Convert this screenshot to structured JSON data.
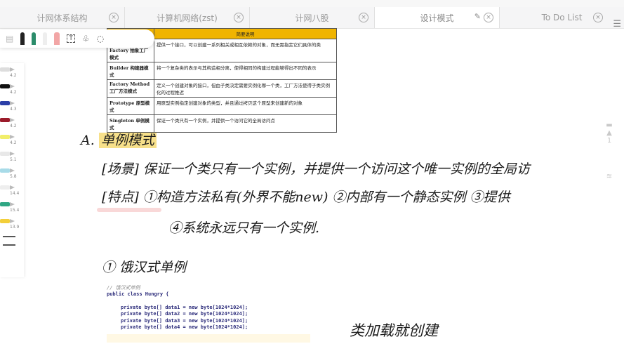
{
  "tabs": [
    {
      "label": "计网体系结构"
    },
    {
      "label": "计算机网络(zst)"
    },
    {
      "label": "计网八股"
    },
    {
      "label": "设计模式",
      "active": true
    },
    {
      "label": "To Do List"
    }
  ],
  "pens": [
    {
      "color": "#d8d8d8",
      "size": "4.2"
    },
    {
      "color": "#111111",
      "size": "4.2"
    },
    {
      "color": "#2b3fa8",
      "size": "4.3"
    },
    {
      "color": "#9b1b2a",
      "size": "4.2"
    },
    {
      "color": "#f1ee6a",
      "size": "4.2"
    },
    {
      "color": "#e8e8e8",
      "size": "5.1"
    },
    {
      "color": "#a8dbe8",
      "size": "5.8"
    },
    {
      "color": "#eeeeee",
      "size": "14.4"
    },
    {
      "color": "#2fa784",
      "size": "15.4"
    },
    {
      "color": "#f3cf3a",
      "size": "13.9"
    }
  ],
  "table": {
    "header": "简要说明",
    "rows": [
      {
        "name": "Abstract Factory 抽象工厂模式",
        "desc": "提供一个接口，可以创建一系列相关或相互依赖的对象，而无需指定它们具体的类"
      },
      {
        "name": "Builder 构建器模式",
        "desc": "将一个复杂类的表示与其构造相分离，使得相同的构建过程能够得出不同的表示"
      },
      {
        "name": "Factory Method 工厂方法模式",
        "desc": "定义一个创建对象的接口，但由子类决定需要实例化哪一个类，工厂方法使得子类实例化的过程推迟"
      },
      {
        "name": "Prototype 原型模式",
        "desc": "用原型实例指定创建对象的类型，并且通过拷贝这个原型来创建新的对象"
      },
      {
        "name": "Singleton 单例模式",
        "desc": "保证一个类只有一个实例，并提供一个访问它的全局访问点"
      }
    ]
  },
  "notes": {
    "heading_prefix": "A.",
    "heading": "单例模式",
    "scene": "[场景]  保证一个类只有一个实例，并提供一个访问这个唯一实例的全局访",
    "feature": "[特点]  ①构造方法私有(外界不能new)  ②内部有一个静态实例  ③提供",
    "feature2": "④系统永远只有一个实例.",
    "sub": "① 饿汉式单例",
    "side": "类加载就创建"
  },
  "code": {
    "comment": "// 饿汉式单例",
    "class_line": "public class Hungry {",
    "lines": [
      "private byte[] data1 = new byte[1024*1024];",
      "private byte[] data2 = new byte[1024*1024];",
      "private byte[] data3 = new byte[1024*1024];",
      "private byte[] data4 = new byte[1024*1024];"
    ]
  },
  "page_number": "1"
}
